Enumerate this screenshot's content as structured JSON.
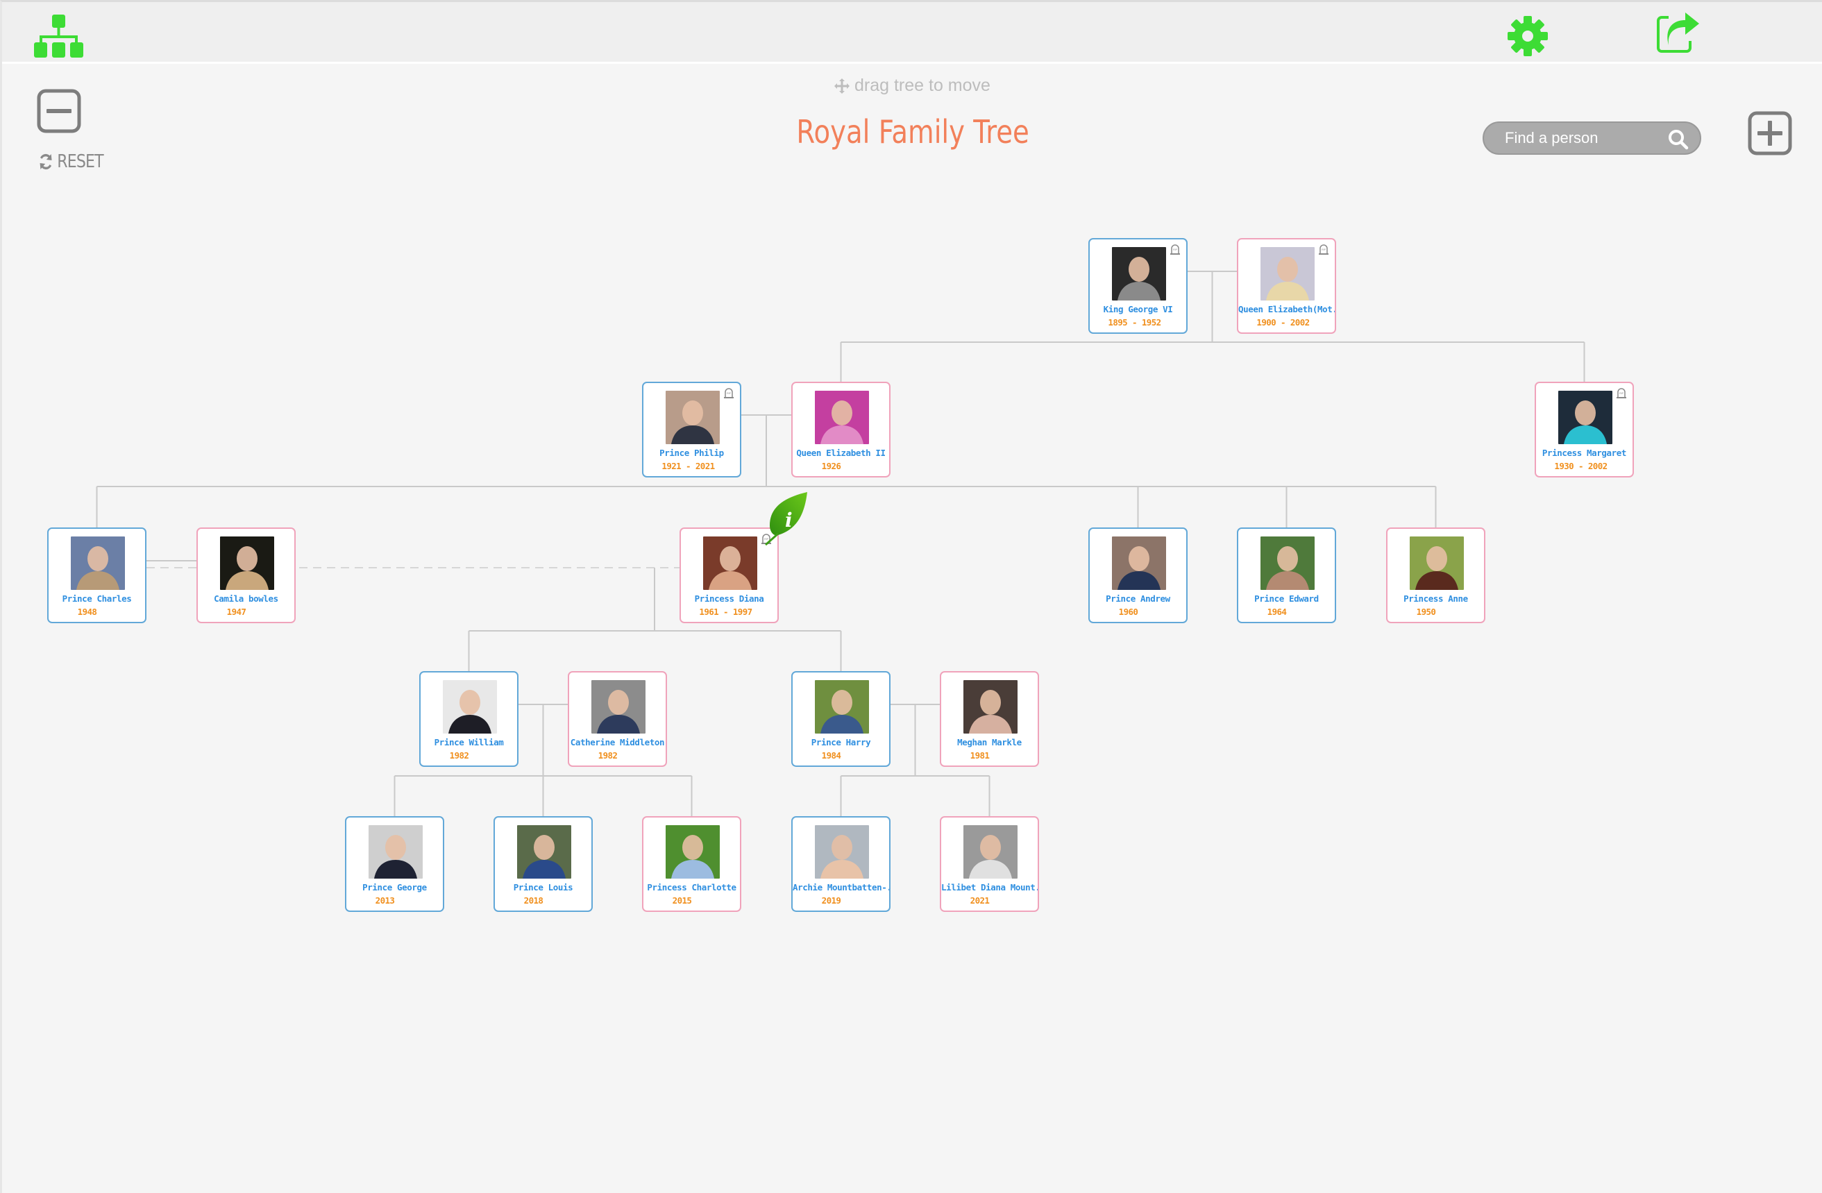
{
  "app": {
    "title": "Royal Family Tree",
    "drag_hint": "drag tree to move",
    "reset_label": "RESET",
    "search": {
      "placeholder": "Find a person",
      "value": ""
    },
    "accent_color": "#3ddc35",
    "title_color": "#f2805a"
  },
  "toolbar": {
    "icons": [
      "family-tree-icon",
      "gear-icon",
      "share-icon"
    ]
  },
  "zoom_controls": [
    "zoom-out-icon",
    "zoom-in-icon"
  ],
  "people": [
    {
      "id": "george6",
      "name": "King George VI",
      "dates": "1895 - 1952",
      "gender": "male",
      "deceased": true,
      "photo_tone": [
        "#2a2a2a",
        "#8a8a8a"
      ]
    },
    {
      "id": "queenmother",
      "name": "Queen Elizabeth(Mot..",
      "dates": "1900 - 2002",
      "gender": "female",
      "deceased": true,
      "photo_tone": [
        "#c9c7d6",
        "#e8d7a8"
      ]
    },
    {
      "id": "philip",
      "name": "Prince Philip",
      "dates": "1921 - 2021",
      "gender": "male",
      "deceased": true,
      "photo_tone": [
        "#b89c8a",
        "#2f3442"
      ]
    },
    {
      "id": "elizabeth2",
      "name": "Queen Elizabeth II",
      "dates": "1926",
      "gender": "female",
      "deceased": false,
      "photo_tone": [
        "#c43fa0",
        "#e28bc6"
      ]
    },
    {
      "id": "margaret",
      "name": "Princess Margaret",
      "dates": "1930 - 2002",
      "gender": "female",
      "deceased": true,
      "photo_tone": [
        "#1e2c3a",
        "#2bbfd0"
      ]
    },
    {
      "id": "charles",
      "name": "Prince Charles",
      "dates": "1948",
      "gender": "male",
      "deceased": false,
      "photo_tone": [
        "#6b7fa6",
        "#b79a77"
      ]
    },
    {
      "id": "camilla",
      "name": "Camila bowles",
      "dates": "1947",
      "gender": "female",
      "deceased": false,
      "photo_tone": [
        "#1a1a14",
        "#c9a77c"
      ]
    },
    {
      "id": "diana",
      "name": "Princess Diana",
      "dates": "1961 - 1997",
      "gender": "female",
      "deceased": true,
      "photo_tone": [
        "#7a3b2a",
        "#d9a283"
      ]
    },
    {
      "id": "andrew",
      "name": "Prince Andrew",
      "dates": "1960",
      "gender": "male",
      "deceased": false,
      "photo_tone": [
        "#8c7468",
        "#243456"
      ]
    },
    {
      "id": "edward",
      "name": "Prince Edward",
      "dates": "1964",
      "gender": "male",
      "deceased": false,
      "photo_tone": [
        "#4f7a3b",
        "#b48a72"
      ]
    },
    {
      "id": "anne",
      "name": "Princess Anne",
      "dates": "1950",
      "gender": "female",
      "deceased": false,
      "photo_tone": [
        "#8aa34a",
        "#5a2a1e"
      ]
    },
    {
      "id": "william",
      "name": "Prince William",
      "dates": "1982",
      "gender": "male",
      "deceased": false,
      "photo_tone": [
        "#e8e8e8",
        "#1e1e26"
      ]
    },
    {
      "id": "catherine",
      "name": "Catherine Middleton",
      "dates": "1982",
      "gender": "female",
      "deceased": false,
      "photo_tone": [
        "#8c8c8c",
        "#2d3b5c"
      ]
    },
    {
      "id": "harry",
      "name": "Prince Harry",
      "dates": "1984",
      "gender": "male",
      "deceased": false,
      "photo_tone": [
        "#6f8f3f",
        "#3a5a8c"
      ]
    },
    {
      "id": "meghan",
      "name": "Meghan Markle",
      "dates": "1981",
      "gender": "female",
      "deceased": false,
      "photo_tone": [
        "#4a3d38",
        "#d6b0a0"
      ]
    },
    {
      "id": "george",
      "name": "Prince George",
      "dates": "2013",
      "gender": "male",
      "deceased": false,
      "photo_tone": [
        "#cfcfcf",
        "#1e2233"
      ]
    },
    {
      "id": "louis",
      "name": "Prince Louis",
      "dates": "2018",
      "gender": "male",
      "deceased": false,
      "photo_tone": [
        "#5a6b4a",
        "#2a4a8a"
      ]
    },
    {
      "id": "charlotte",
      "name": "Princess Charlotte",
      "dates": "2015",
      "gender": "female",
      "deceased": false,
      "photo_tone": [
        "#4f8f2f",
        "#9cbce0"
      ]
    },
    {
      "id": "archie",
      "name": "Archie Mountbatten-..",
      "dates": "2019",
      "gender": "male",
      "deceased": false,
      "photo_tone": [
        "#b0b8c0",
        "#e8c3a8"
      ]
    },
    {
      "id": "lilibet",
      "name": "Lilibet Diana Mount..",
      "dates": "2021",
      "gender": "female",
      "deceased": false,
      "photo_tone": [
        "#9a9a9a",
        "#e0e0e0"
      ]
    }
  ],
  "relationships": {
    "couples": [
      [
        "george6",
        "queenmother"
      ],
      [
        "philip",
        "elizabeth2"
      ],
      [
        "charles",
        "camilla"
      ],
      [
        "william",
        "catherine"
      ],
      [
        "harry",
        "meghan"
      ]
    ],
    "former_couples": [
      [
        "charles",
        "diana"
      ]
    ],
    "children": {
      "george6+queenmother": [
        "elizabeth2",
        "margaret"
      ],
      "philip+elizabeth2": [
        "charles",
        "andrew",
        "edward",
        "anne"
      ],
      "charles+diana": [
        "william",
        "harry"
      ],
      "william+catherine": [
        "george",
        "louis",
        "charlotte"
      ],
      "harry+meghan": [
        "archie",
        "lilibet"
      ]
    }
  },
  "info_badge": {
    "label": "i",
    "attached_to": "diana"
  }
}
